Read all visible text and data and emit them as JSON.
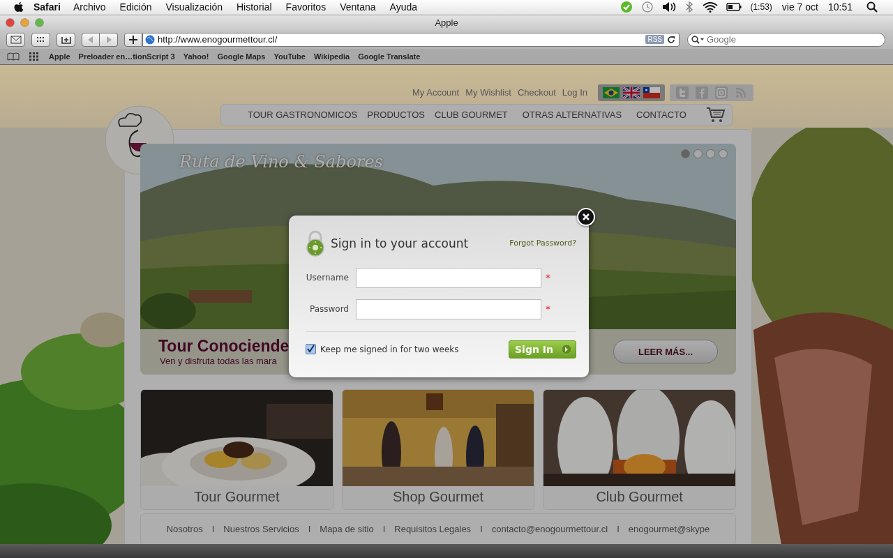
{
  "menubar": {
    "app": "Safari",
    "menus": [
      "Archivo",
      "Edición",
      "Visualización",
      "Historial",
      "Favoritos",
      "Ventana",
      "Ayuda"
    ],
    "battery_time": "(1:53)",
    "date": "vie 7 oct",
    "time": "10:51"
  },
  "browser": {
    "title": "Apple",
    "url": "http://www.enogourmettour.cl/",
    "rss": "RSS",
    "search": {
      "placeholder": "Google"
    },
    "bookmarks": [
      "Apple",
      "Preloader en…tionScript 3",
      "Yahoo!",
      "Google Maps",
      "YouTube",
      "Wikipedia",
      "Google Translate"
    ]
  },
  "site": {
    "account_links": [
      "My Account",
      "My Wishlist",
      "Checkout",
      "Log In"
    ],
    "nav": [
      "TOUR GASTRONOMICOS",
      "PRODUCTOS",
      "CLUB GOURMET",
      "OTRAS ALTERNATIVAS",
      "CONTACTO"
    ],
    "hero": {
      "script_title": "Ruta de Vino & Sabores",
      "dots": [
        {
          "selected": true
        },
        {
          "selected": false
        },
        {
          "selected": false
        },
        {
          "selected": false
        }
      ],
      "title": "Tour Conociende",
      "subtitle": "Ven y disfruta todas las mara",
      "button": "LEER MÁS..."
    },
    "cards": [
      {
        "label": "Tour Gourmet"
      },
      {
        "label": "Shop Gourmet"
      },
      {
        "label": "Club Gourmet"
      }
    ],
    "footer": {
      "separators": [
        "I",
        "I",
        "I",
        "I",
        "I"
      ],
      "links": [
        "Nosotros",
        "Nuestros Servicios",
        "Mapa de sitio",
        "Requisitos Legales",
        "contacto@enogourmettour.cl",
        "enogourmet@skype"
      ]
    }
  },
  "modal": {
    "title": "Sign in to your account",
    "forgot": "Forgot Password?",
    "fields": [
      {
        "label": "Username",
        "required_mark": "*"
      },
      {
        "label": "Password",
        "required_mark": "*"
      }
    ],
    "remember": {
      "label": "Keep me signed in for two weeks",
      "checked": true
    },
    "submit": "Sign In"
  }
}
